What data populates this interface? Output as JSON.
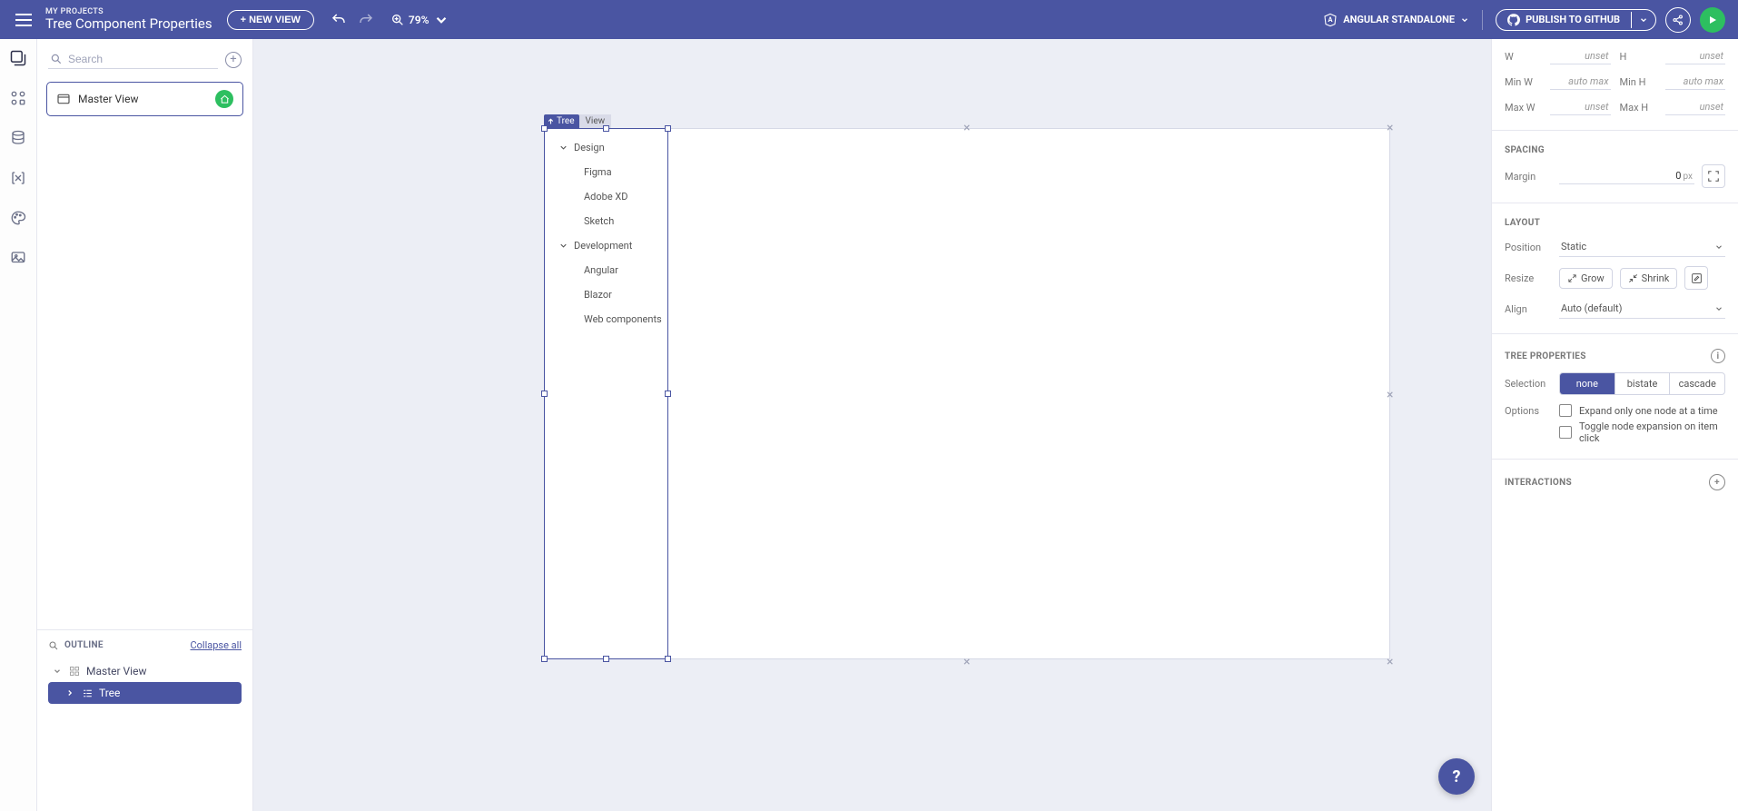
{
  "header": {
    "breadcrumb": "MY PROJECTS",
    "title": "Tree Component Properties",
    "new_view": "+ NEW VIEW",
    "zoom": "79%",
    "framework": "ANGULAR STANDALONE",
    "publish": "PUBLISH TO GITHUB"
  },
  "left": {
    "search_placeholder": "Search",
    "views": [
      {
        "name": "Master View",
        "home": true
      }
    ],
    "outline": {
      "title": "OUTLINE",
      "collapse": "Collapse all",
      "root": "Master View",
      "selected": "Tree"
    }
  },
  "canvas": {
    "sel_tag": "Tree",
    "view_tag": "View",
    "tree": {
      "design": {
        "label": "Design",
        "items": [
          "Figma",
          "Adobe XD",
          "Sketch"
        ]
      },
      "development": {
        "label": "Development",
        "items": [
          "Angular",
          "Blazor",
          "Web components"
        ]
      }
    }
  },
  "props": {
    "size": {
      "w_label": "W",
      "w": "unset",
      "h_label": "H",
      "h": "unset",
      "minw_label": "Min W",
      "minw": "auto max",
      "minh_label": "Min H",
      "minh": "auto max",
      "maxw_label": "Max W",
      "maxw": "unset",
      "maxh_label": "Max H",
      "maxh": "unset"
    },
    "spacing": {
      "title": "SPACING",
      "margin_label": "Margin",
      "margin_val": "0",
      "margin_unit": "px"
    },
    "layout": {
      "title": "LAYOUT",
      "position_label": "Position",
      "position": "Static",
      "resize_label": "Resize",
      "grow": "Grow",
      "shrink": "Shrink",
      "align_label": "Align",
      "align": "Auto (default)"
    },
    "tree_props": {
      "title": "TREE PROPERTIES",
      "selection_label": "Selection",
      "seg": [
        "none",
        "bistate",
        "cascade"
      ],
      "options_label": "Options",
      "opt1": "Expand only one node at a time",
      "opt2": "Toggle node expansion on item click"
    },
    "interactions": {
      "title": "INTERACTIONS"
    }
  },
  "help": "?"
}
